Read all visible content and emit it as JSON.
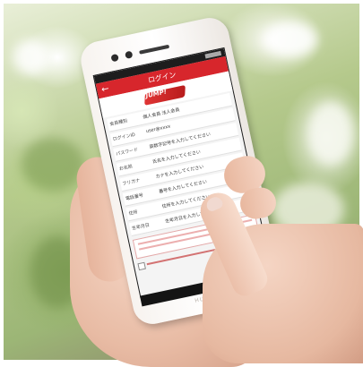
{
  "photo": {
    "description_colors": {
      "foliage": "#9cb676",
      "highlight": "#ffffff",
      "skin": "#f2cdb9"
    }
  },
  "phone": {
    "brand_label": "HUAWEI",
    "screen": {
      "app_bar_color": "#d7262c",
      "app_title": "ログイン",
      "back_icon": "arrow-left-icon",
      "logo_text": "JUMP!",
      "form_rows": [
        {
          "label": "会員種別",
          "value": "個人会員 法人会員"
        },
        {
          "label": "ログインID",
          "value": "user@xxxx"
        },
        {
          "label": "パスワード",
          "value": "英数字記号を入力してください"
        },
        {
          "label": "お名前",
          "value": "氏名を入力してください"
        },
        {
          "label": "フリガナ",
          "value": "カナを入力してください"
        },
        {
          "label": "電話番号",
          "value": "番号を入力してください"
        },
        {
          "label": "住所",
          "value": "住所を入力してください"
        },
        {
          "label": "生年月日",
          "value": "生年月日を入力してください"
        }
      ]
    }
  }
}
